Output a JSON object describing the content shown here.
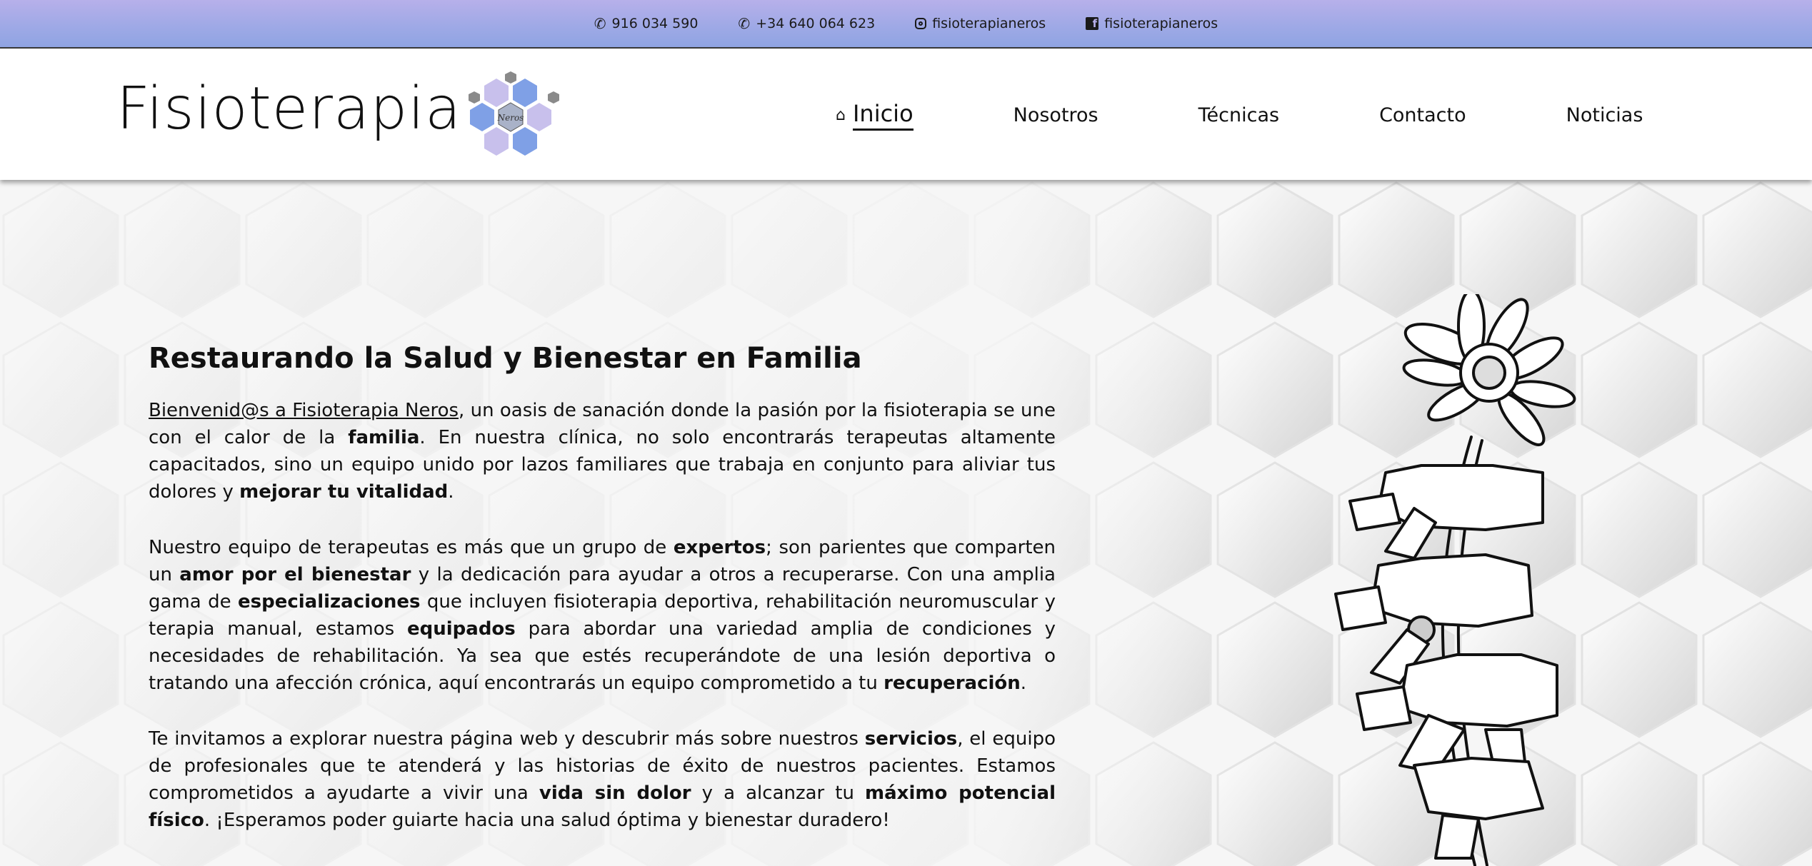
{
  "topbar": {
    "phone": "916 034 590",
    "whatsapp": "+34 640 064 623",
    "instagram": "fisioterapianeros",
    "facebook": "fisioterapianeros"
  },
  "header": {
    "brand": "Fisioterapia",
    "logo_text": "Neros",
    "nav": [
      {
        "label": "Inicio",
        "active": true
      },
      {
        "label": "Nosotros"
      },
      {
        "label": "Técnicas"
      },
      {
        "label": "Contacto"
      },
      {
        "label": "Noticias"
      }
    ]
  },
  "colors": {
    "topbar_gradient": [
      "#b7b0ea",
      "#8fa4e2"
    ],
    "hex_blue": "#7fa0e6",
    "hex_lavender": "#c8c0ec",
    "hex_gray": "#8a8a8a"
  },
  "hero": {
    "title": "Restaurando la Salud y Bienestar en Familia",
    "p1": {
      "link": "Bienvenid@s a Fisioterapia Neros",
      "t1": ", un oasis de sanación donde la pasión por la fisioterapia se une con el calor de la ",
      "b1": "familia",
      "t2": ". En nuestra clínica, no solo encontrarás terapeutas altamente capacitados, sino un equipo unido por lazos familiares que trabaja en conjunto para aliviar tus dolores y ",
      "b2": "mejorar tu vitalidad",
      "t3": "."
    },
    "p2": {
      "t1": "Nuestro equipo de terapeutas es más que un grupo de ",
      "b1": "expertos",
      "t2": "; son parientes que comparten un ",
      "b2": "amor por el bienestar",
      "t3": " y la dedicación para ayudar a otros a recuperarse. Con una amplia gama de ",
      "b3": "especializaciones",
      "t4": " que incluyen fisioterapia deportiva, rehabilitación neuromuscular y terapia manual, estamos ",
      "b4": "equipados",
      "t5": " para abordar una variedad amplia de condiciones y necesidades de rehabilitación. Ya sea que estés recuperándote de una lesión deportiva o tratando una afección crónica, aquí encontrarás un equipo comprometido a tu ",
      "b5": "recuperación",
      "t6": "."
    },
    "p3": {
      "t1": "Te invitamos a explorar nuestra página web y descubrir más sobre nuestros ",
      "b1": "servicios",
      "t2": ", el equipo de profesionales que te atenderá y las historias de éxito de nuestros pacientes. Estamos comprometidos a ayudarte a vivir una ",
      "b2": "vida sin dolor",
      "t3": " y a alcanzar tu ",
      "b3": "máximo potencial físico",
      "t4": ". ¡Esperamos poder guiarte hacia una salud óptima y bienestar duradero!"
    }
  }
}
